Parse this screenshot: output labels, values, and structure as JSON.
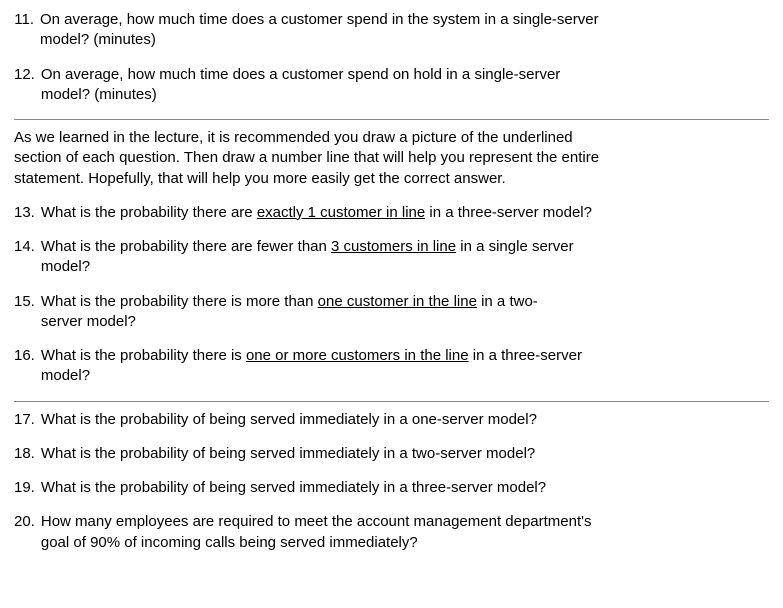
{
  "q11": {
    "num": "11.",
    "line1": "On average, how much time does a customer spend in the system in a single-server",
    "line2": "model? (minutes)"
  },
  "q12": {
    "num": "12.",
    "line1": "On average, how much time does a customer spend on hold in a single-server",
    "line2": "model? (minutes)"
  },
  "instruction": {
    "line1": "As we learned in the lecture, it is recommended you draw a picture of the underlined",
    "line2": "section of each question.  Then draw a number line that will help you represent the entire",
    "line3": "statement.  Hopefully, that will help you more easily get the correct answer."
  },
  "q13": {
    "num": "13.",
    "pre": "What is the probability there are ",
    "u": "exactly 1 customer in line",
    "post": " in a three-server model?"
  },
  "q14": {
    "num": "14.",
    "pre": "What is the probability there are fewer than ",
    "u": "3 customers in line",
    "post": " in a single server",
    "line2": "model?"
  },
  "q15": {
    "num": "15.",
    "pre": "What is the probability there is more than ",
    "u": "one customer in the line",
    "post": " in a two-",
    "line2": "server model?"
  },
  "q16": {
    "num": "16.",
    "pre": "What is the probability there is ",
    "u": "one or more customers in the line",
    "post": " in a three-server",
    "line2": "model?"
  },
  "q17": {
    "num": "17.",
    "text": "What is the probability of being served immediately in a one-server model?"
  },
  "q18": {
    "num": "18.",
    "text": "What is the probability of being served immediately in a two-server model?"
  },
  "q19": {
    "num": "19.",
    "text": "What is the probability of being served immediately in a three-server model?"
  },
  "q20": {
    "num": "20.",
    "line1": "How many employees are required to meet the account management department's",
    "line2": "goal of 90% of incoming calls being served immediately?"
  }
}
